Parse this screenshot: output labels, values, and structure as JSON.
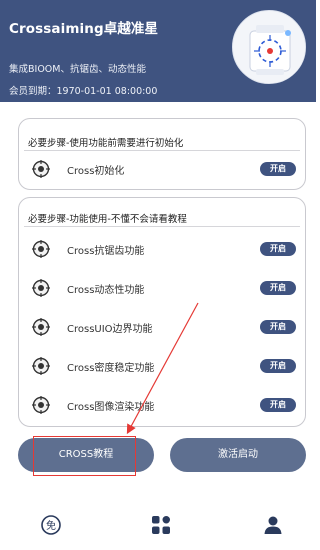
{
  "header": {
    "title": "Crossaiming卓越准星",
    "features": "集成BIOOM、抗锯齿、动态性能",
    "expiry": "会员到期：1970-01-01 08:00:00",
    "logo": "crosshair-logo"
  },
  "card1": {
    "title": "必要步骤-使用功能前需要进行初始化",
    "rows": [
      {
        "label": "Cross初始化",
        "toggle": "开启",
        "icon": "crosshair-icon"
      }
    ]
  },
  "card2": {
    "title": "必要步骤-功能使用-不懂不会请看教程",
    "rows": [
      {
        "label": "Cross抗锯齿功能",
        "toggle": "开启",
        "icon": "crosshair-icon"
      },
      {
        "label": "Cross动态性功能",
        "toggle": "开启",
        "icon": "crosshair-icon"
      },
      {
        "label": "CrossUIO边界功能",
        "toggle": "开启",
        "icon": "crosshair-icon"
      },
      {
        "label": "Cross密度稳定功能",
        "toggle": "开启",
        "icon": "crosshair-icon"
      },
      {
        "label": "Cross图像渲染功能",
        "toggle": "开启",
        "icon": "crosshair-icon"
      }
    ]
  },
  "buttons": {
    "tutorial": "CROSS教程",
    "activate": "激活启动"
  },
  "nav": {
    "left_icon": "free-icon",
    "left_glyph": "免",
    "center_icon": "apps-grid-icon",
    "right_icon": "user-icon"
  },
  "colors": {
    "header_bg": "#3f5380",
    "toggle_bg": "#3f5380",
    "button_bg": "#5e6f90",
    "annotation": "#e53935"
  }
}
